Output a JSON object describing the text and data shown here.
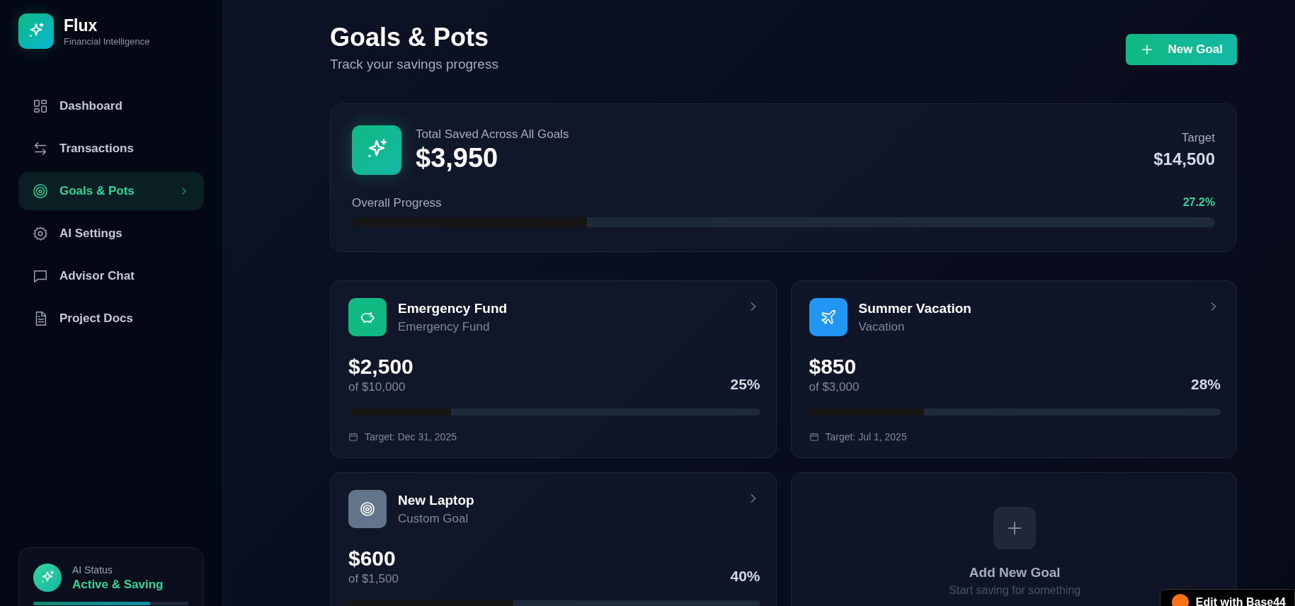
{
  "brand": {
    "name": "Flux",
    "tagline": "Financial Intelligence"
  },
  "nav": [
    {
      "label": "Dashboard",
      "selected": false
    },
    {
      "label": "Transactions",
      "selected": false
    },
    {
      "label": "Goals & Pots",
      "selected": true
    },
    {
      "label": "AI Settings",
      "selected": false
    },
    {
      "label": "Advisor Chat",
      "selected": false
    },
    {
      "label": "Project Docs",
      "selected": false
    }
  ],
  "ai_status": {
    "label": "AI Status",
    "value": "Active & Saving",
    "level": 0.75
  },
  "header": {
    "title": "Goals & Pots",
    "subtitle": "Track your savings progress",
    "button": "New Goal"
  },
  "summary": {
    "label": "Total Saved Across All Goals",
    "amount": "$3,950",
    "target_label": "Target",
    "target": "$14,500",
    "progress_label": "Overall Progress",
    "percent": "27.2%",
    "level": 0.272
  },
  "goals": [
    {
      "kind": "emergency",
      "color": "#10b981",
      "name": "Emergency Fund",
      "category": "Emergency Fund",
      "amount": "$2,500",
      "of": "of $10,000",
      "percent": "25%",
      "level": 0.25,
      "target": "Target: Dec 31, 2025"
    },
    {
      "kind": "vacation",
      "color": "#2196f3",
      "name": "Summer Vacation",
      "category": "Vacation",
      "amount": "$850",
      "of": "of $3,000",
      "percent": "28%",
      "level": 0.28,
      "target": "Target: Jul 1, 2025"
    },
    {
      "kind": "custom",
      "color": "#64748b",
      "name": "New Laptop",
      "category": "Custom Goal",
      "amount": "$600",
      "of": "of $1,500",
      "percent": "40%",
      "level": 0.4
    }
  ],
  "add_card": {
    "title": "Add New Goal",
    "subtitle": "Start saving for something"
  },
  "badge": {
    "text": "Edit with Base44"
  }
}
